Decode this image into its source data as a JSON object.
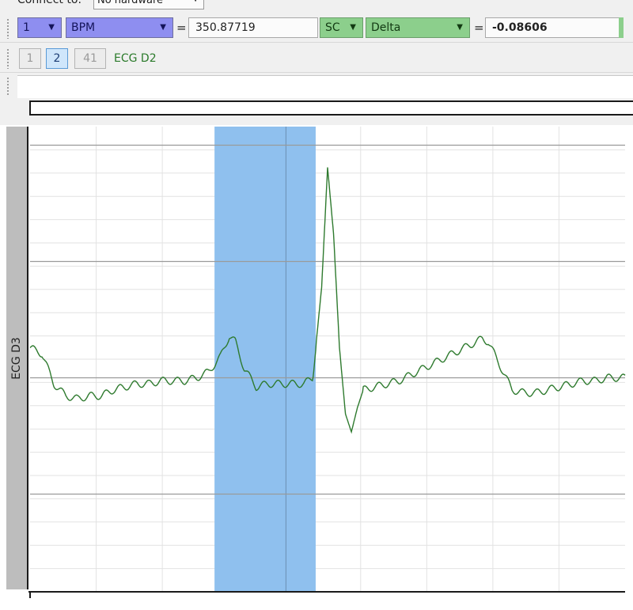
{
  "connect": {
    "label": "Connect to:",
    "device": "No hardware"
  },
  "measurement1": {
    "channel": "1",
    "type": "BPM",
    "equals": "=",
    "value": "350.87719"
  },
  "measurement2": {
    "channel": "SC",
    "type": "Delta",
    "equals": "=",
    "value": "-0.08606"
  },
  "pages": [
    {
      "label": "1",
      "active": false
    },
    {
      "label": "2",
      "active": true
    },
    {
      "label": "41",
      "active": false
    }
  ],
  "channel_title": "ECG D2",
  "plot": {
    "ylabel": "ECG D3"
  },
  "colors": {
    "trace": "#2e7a2e",
    "selection": "#8fc0ee",
    "grid_major": "#9a9a9a",
    "grid_minor": "#e2e2e2"
  },
  "icons": [
    "chevron-down-icon",
    "toolbar-grip-icon"
  ],
  "chart_data": {
    "type": "line",
    "ylabel": "ECG D3",
    "selection": {
      "x_start": 0.31,
      "x_end": 0.48
    },
    "trace_points": [
      [
        0.0,
        0.1
      ],
      [
        0.02,
        0.08
      ],
      [
        0.04,
        -0.02
      ],
      [
        0.06,
        -0.06
      ],
      [
        0.08,
        -0.07
      ],
      [
        0.1,
        -0.06
      ],
      [
        0.12,
        -0.06
      ],
      [
        0.14,
        -0.04
      ],
      [
        0.16,
        -0.03
      ],
      [
        0.18,
        -0.02
      ],
      [
        0.2,
        -0.02
      ],
      [
        0.22,
        -0.01
      ],
      [
        0.24,
        -0.01
      ],
      [
        0.26,
        -0.01
      ],
      [
        0.28,
        0.0
      ],
      [
        0.3,
        0.02
      ],
      [
        0.32,
        0.07
      ],
      [
        0.335,
        0.14
      ],
      [
        0.345,
        0.12
      ],
      [
        0.36,
        0.03
      ],
      [
        0.37,
        0.0
      ],
      [
        0.38,
        -0.03
      ],
      [
        0.4,
        -0.02
      ],
      [
        0.42,
        -0.02
      ],
      [
        0.44,
        -0.02
      ],
      [
        0.46,
        -0.02
      ],
      [
        0.475,
        0.0
      ],
      [
        0.49,
        0.3
      ],
      [
        0.5,
        0.7
      ],
      [
        0.51,
        0.48
      ],
      [
        0.52,
        0.1
      ],
      [
        0.53,
        -0.12
      ],
      [
        0.54,
        -0.18
      ],
      [
        0.55,
        -0.1
      ],
      [
        0.56,
        -0.04
      ],
      [
        0.58,
        -0.03
      ],
      [
        0.6,
        -0.02
      ],
      [
        0.62,
        -0.01
      ],
      [
        0.64,
        0.01
      ],
      [
        0.66,
        0.03
      ],
      [
        0.68,
        0.05
      ],
      [
        0.7,
        0.07
      ],
      [
        0.72,
        0.09
      ],
      [
        0.74,
        0.11
      ],
      [
        0.76,
        0.13
      ],
      [
        0.77,
        0.12
      ],
      [
        0.79,
        0.04
      ],
      [
        0.81,
        -0.04
      ],
      [
        0.83,
        -0.05
      ],
      [
        0.85,
        -0.05
      ],
      [
        0.87,
        -0.04
      ],
      [
        0.89,
        -0.03
      ],
      [
        0.91,
        -0.02
      ],
      [
        0.93,
        -0.01
      ],
      [
        0.95,
        -0.01
      ],
      [
        0.97,
        0.0
      ],
      [
        1.0,
        0.0
      ]
    ]
  }
}
